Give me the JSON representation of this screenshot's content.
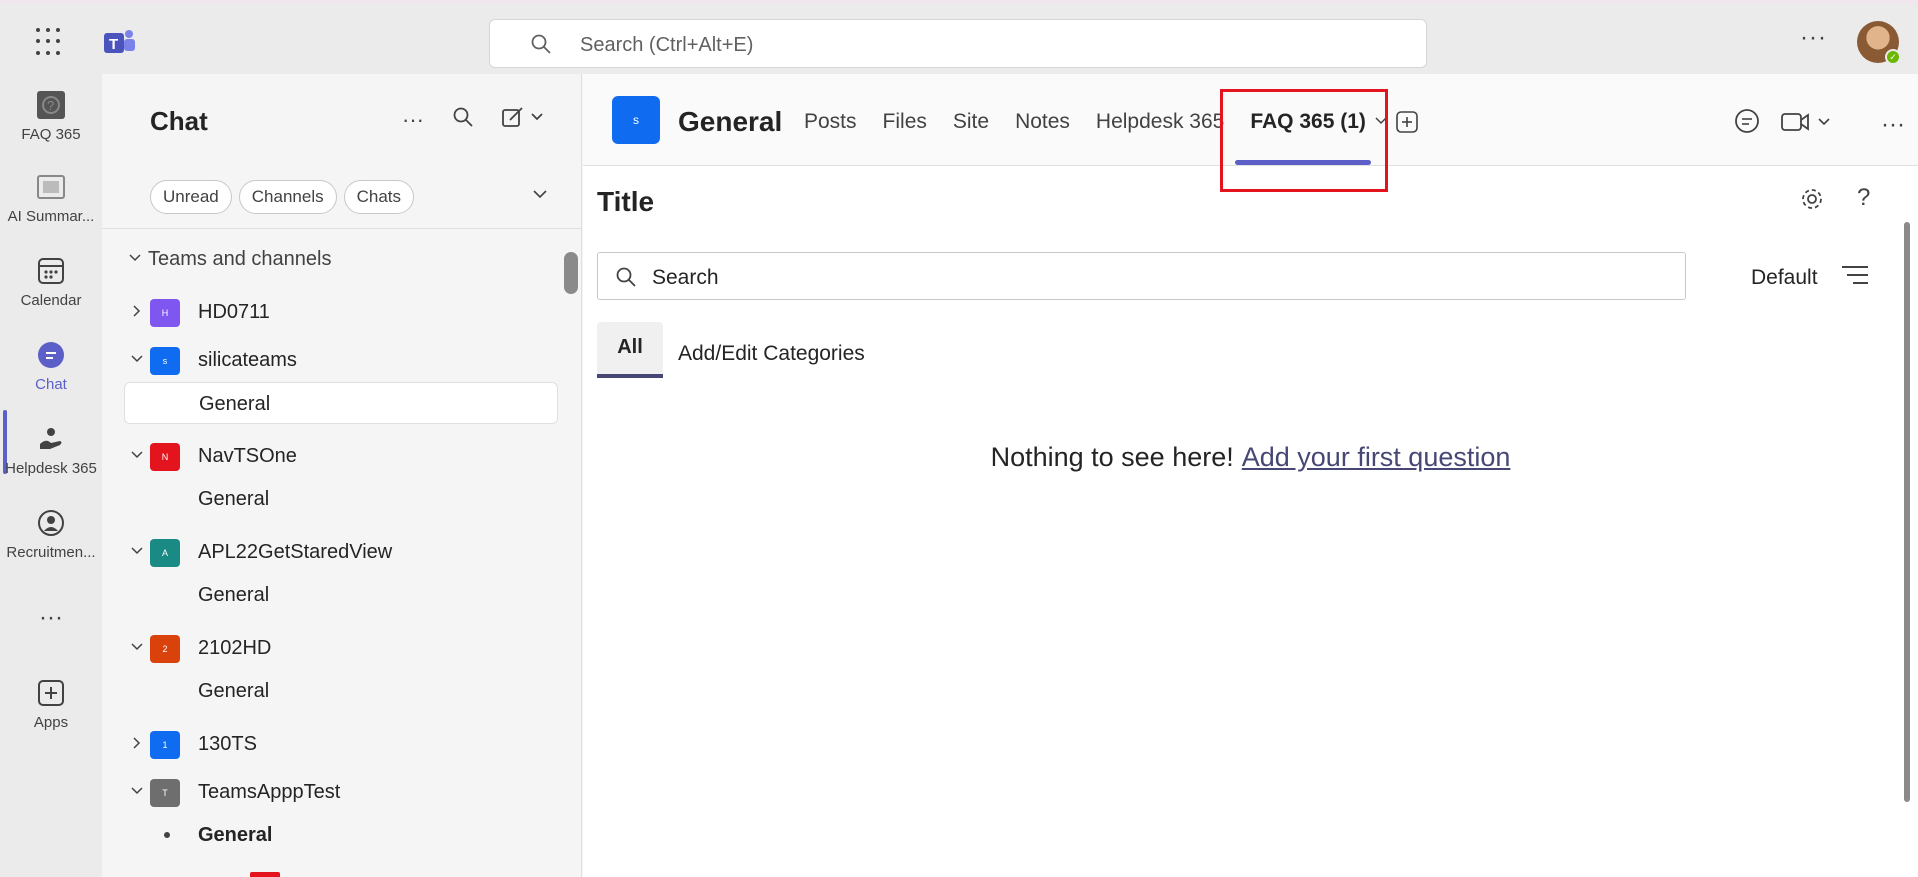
{
  "topbar": {
    "search_placeholder": "Search (Ctrl+Alt+E)",
    "more_label": "···"
  },
  "rail": {
    "items": [
      {
        "label": "FAQ 365",
        "icon": "faq-app-icon"
      },
      {
        "label": "AI Summar...",
        "icon": "ai-summary-app-icon"
      },
      {
        "label": "Calendar",
        "icon": "calendar-icon"
      },
      {
        "label": "Chat",
        "icon": "chat-icon",
        "active": true
      },
      {
        "label": "Helpdesk 365",
        "icon": "helpdesk-icon"
      },
      {
        "label": "Recruitmen...",
        "icon": "recruitment-icon"
      },
      {
        "label": "···",
        "icon": "more-apps-icon"
      },
      {
        "label": "Apps",
        "icon": "apps-icon"
      }
    ]
  },
  "side": {
    "title": "Chat",
    "filters": [
      "Unread",
      "Channels",
      "Chats"
    ],
    "section": "Teams and channels",
    "teams": [
      {
        "name": "HD0711",
        "initial": "H",
        "color": "#7f56f0",
        "expanded": false
      },
      {
        "name": "silicateams",
        "initial": "s",
        "color": "#0f6cf0",
        "expanded": true
      },
      {
        "name": "NavTSOne",
        "initial": "N",
        "color": "#e3141e",
        "expanded": true
      },
      {
        "name": "APL22GetStaredView",
        "initial": "A",
        "color": "#1a8a84",
        "expanded": true
      },
      {
        "name": "2102HD",
        "initial": "2",
        "color": "#d9420b",
        "expanded": true
      },
      {
        "name": "130TS",
        "initial": "1",
        "color": "#0f6cf0",
        "expanded": false
      },
      {
        "name": "TeamsApppTest",
        "initial": "T",
        "color": "#6e6e6e",
        "expanded": true
      }
    ],
    "channels": [
      "General",
      "General",
      "General",
      "General",
      "General"
    ]
  },
  "main": {
    "channel_initial": "s",
    "channel_name": "General",
    "tabs": [
      "Posts",
      "Files",
      "Site",
      "Notes",
      "Helpdesk 365"
    ],
    "active_tab": "FAQ 365 (1)",
    "content_title": "Title",
    "search_placeholder": "Search",
    "sort_label": "Default",
    "category_all": "All",
    "add_categories": "Add/Edit Categories",
    "empty_text": "Nothing to see here!",
    "empty_link": "Add your first question",
    "help_label": "?"
  },
  "colors": {
    "accent": "#5b5fc7",
    "highlight": "#e3141e"
  }
}
